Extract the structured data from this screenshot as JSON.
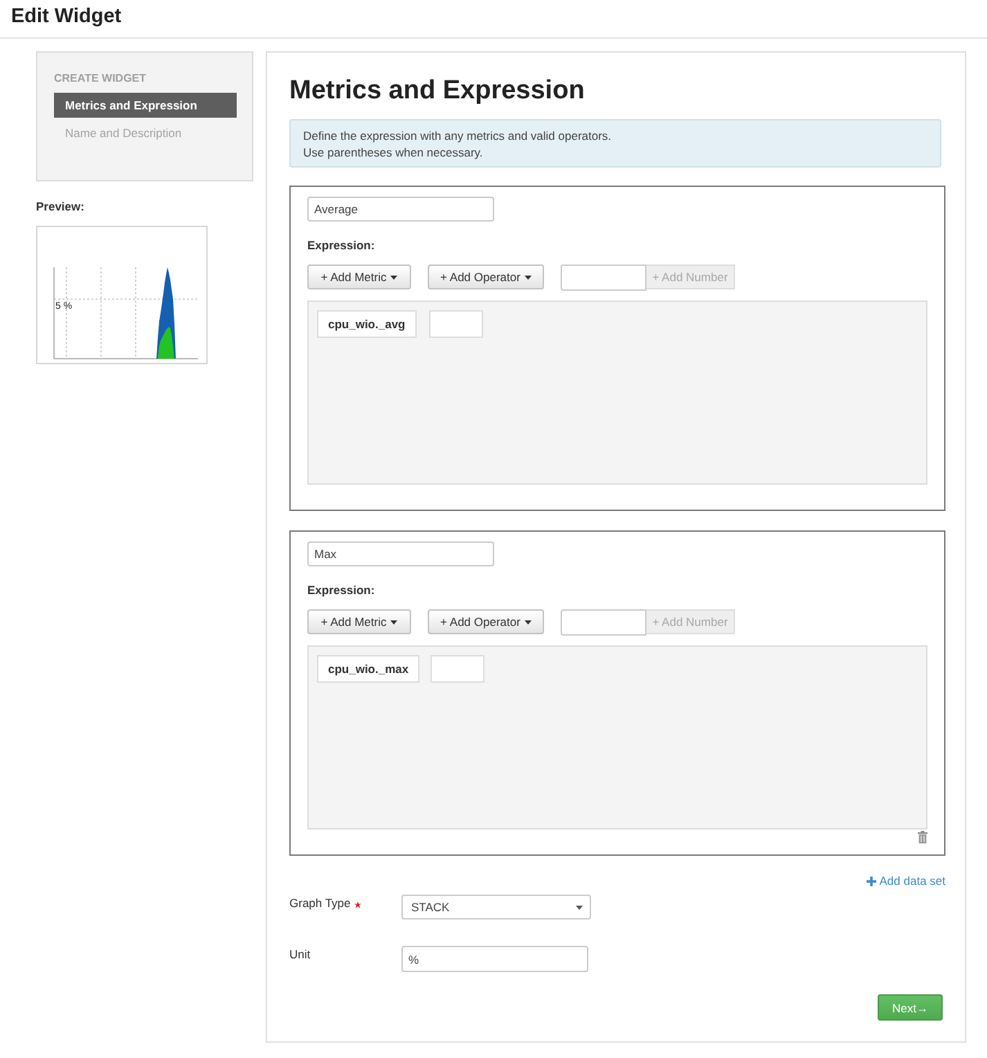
{
  "header": {
    "title": "Edit Widget"
  },
  "sidebar": {
    "section_title": "CREATE WIDGET",
    "steps": [
      {
        "label": "Metrics and Expression",
        "selected": true
      },
      {
        "label": "Name and Description",
        "selected": false
      }
    ]
  },
  "preview": {
    "label": "Preview:",
    "axis_label": "5 %"
  },
  "main": {
    "title": "Metrics and Expression",
    "info_lines": [
      "Define the expression with any metrics and valid operators.",
      "Use parentheses when necessary."
    ]
  },
  "data_sets": [
    {
      "name": "Average",
      "expression_label": "Expression:",
      "add_metric": "+ Add Metric",
      "add_operator": "+ Add Operator",
      "add_number": "+ Add Number",
      "tokens": [
        {
          "kind": "metric",
          "text": "cpu_wio._avg"
        },
        {
          "kind": "blank"
        }
      ],
      "deletable": false
    },
    {
      "name": "Max",
      "expression_label": "Expression:",
      "add_metric": "+ Add Metric",
      "add_operator": "+ Add Operator",
      "add_number": "+ Add Number",
      "tokens": [
        {
          "kind": "metric",
          "text": "cpu_wio._max"
        },
        {
          "kind": "blank"
        }
      ],
      "deletable": true
    }
  ],
  "add_data_set": "Add data set",
  "graph_type": {
    "label": "Graph Type",
    "required": true,
    "value": "STACK"
  },
  "unit": {
    "label": "Unit",
    "value": "%"
  },
  "next_button": "Next→"
}
